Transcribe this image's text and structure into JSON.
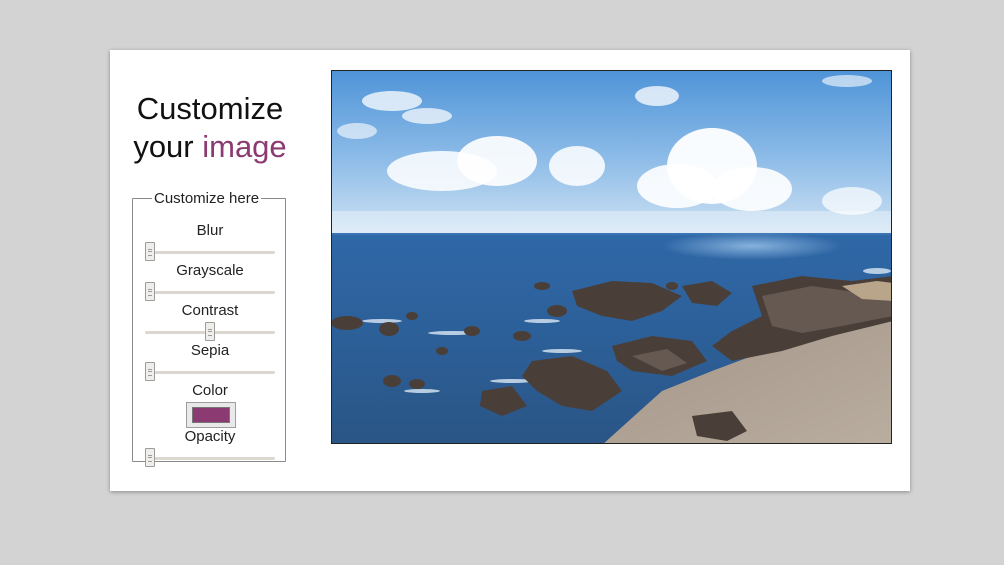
{
  "heading": {
    "line1": "Customize",
    "line2_plain": "your ",
    "line2_accent": "image"
  },
  "panel": {
    "legend": "Customize here",
    "controls": [
      {
        "label": "Blur",
        "type": "range",
        "value_fraction": 0.0
      },
      {
        "label": "Grayscale",
        "type": "range",
        "value_fraction": 0.0
      },
      {
        "label": "Contrast",
        "type": "range",
        "value_fraction": 0.5
      },
      {
        "label": "Sepia",
        "type": "range",
        "value_fraction": 0.0
      },
      {
        "label": "Color",
        "type": "color",
        "value": "#8b3a72"
      },
      {
        "label": "Opacity",
        "type": "range",
        "value_fraction": 0.0
      }
    ]
  },
  "image": {
    "subject": "coastal-seascape-photo"
  },
  "colors": {
    "accent": "#8b3a72",
    "background": "#d3d3d3",
    "card": "#ffffff"
  }
}
